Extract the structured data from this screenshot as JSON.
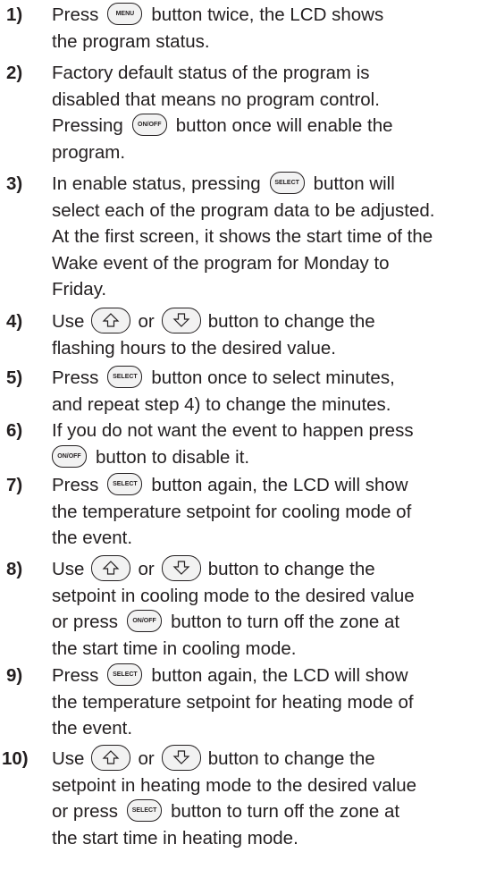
{
  "icons": {
    "menu": "MENU",
    "onoff": "ON/OFF",
    "select": "SELECT",
    "up": "up-arrow-icon",
    "down": "down-arrow-icon"
  },
  "steps": [
    {
      "num": "1)",
      "lines": {
        "l1a": "Press",
        "l1b": "button twice, the LCD shows",
        "l2": "the program status."
      }
    },
    {
      "num": "2)",
      "lines": {
        "l1": "Factory default status of the program is",
        "l2": "disabled that means no program control.",
        "l3a": "Pressing",
        "l3b": "button once will enable the",
        "l4": "program."
      }
    },
    {
      "num": "3)",
      "lines": {
        "l1a": "In enable status, pressing",
        "l1b": "button will",
        "l2": "select each of the program data to be adjusted.",
        "l3": "At the first screen, it shows the start time of the",
        "l4": "Wake event of the program for Monday to",
        "l5": "Friday."
      }
    },
    {
      "num": "4)",
      "lines": {
        "l1a": "Use",
        "l1b": "or",
        "l1c": "button to change the",
        "l2": "flashing hours to the desired value."
      }
    },
    {
      "num": "5)",
      "lines": {
        "l1a": "Press",
        "l1b": "button once to select minutes,",
        "l2": "and repeat step 4) to change the minutes."
      }
    },
    {
      "num": "6)",
      "lines": {
        "l1": "If you do not want the event to happen press",
        "l2b": "button to disable it."
      }
    },
    {
      "num": "7)",
      "lines": {
        "l1a": "Press",
        "l1b": "button again, the LCD will show",
        "l2": "the temperature setpoint for cooling mode of",
        "l3": "the event."
      }
    },
    {
      "num": "8)",
      "lines": {
        "l1a": "Use",
        "l1b": "or",
        "l1c": "button to change the",
        "l2": "setpoint in cooling mode to the desired value",
        "l3a": "or press",
        "l3b": "button to turn off the zone at",
        "l4": "the start time in cooling mode."
      }
    },
    {
      "num": "9)",
      "lines": {
        "l1a": "Press",
        "l1b": "button again, the LCD will show",
        "l2": "the temperature setpoint for heating mode of",
        "l3": "the event."
      }
    },
    {
      "num": "10)",
      "lines": {
        "l1a": "Use",
        "l1b": "or",
        "l1c": "button to change the",
        "l2": "setpoint in heating mode to the desired value",
        "l3a": "or press",
        "l3b": "button to turn off the zone at",
        "l4": "the start time in heating mode."
      }
    }
  ]
}
